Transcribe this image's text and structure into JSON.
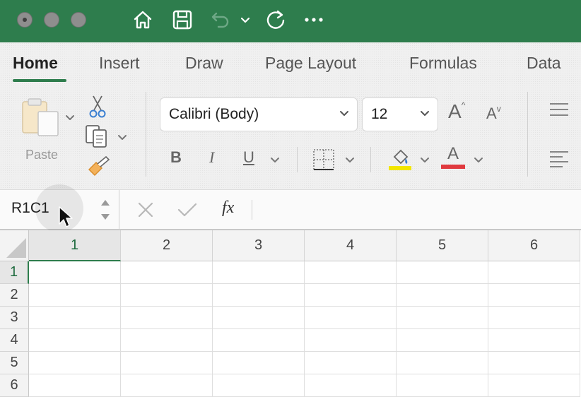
{
  "titlebar": {
    "accent": "#2e7d4d",
    "icons": [
      "home-icon",
      "save-icon",
      "undo-icon",
      "chevron-down-icon",
      "redo-icon",
      "more-icon"
    ]
  },
  "ribbon": {
    "tabs": [
      {
        "label": "Home",
        "active": true
      },
      {
        "label": "Insert"
      },
      {
        "label": "Draw"
      },
      {
        "label": "Page Layout"
      },
      {
        "label": "Formulas"
      },
      {
        "label": "Data"
      }
    ],
    "paste_label": "Paste",
    "font_name": "Calibri (Body)",
    "font_size": "12",
    "bold": "B",
    "italic": "I",
    "underline": "U",
    "font_color_glyph": "A",
    "grow_glyph": "A",
    "shrink_glyph": "A",
    "highlight_color": "#f2e600",
    "font_color": "#e0393e"
  },
  "formula_bar": {
    "name_box": "R1C1",
    "fx_label": "fx",
    "value": ""
  },
  "sheet": {
    "columns": [
      "1",
      "2",
      "3",
      "4",
      "5",
      "6"
    ],
    "rows": [
      "1",
      "2",
      "3",
      "4",
      "5",
      "6"
    ],
    "selected_cell": "R1C1"
  }
}
